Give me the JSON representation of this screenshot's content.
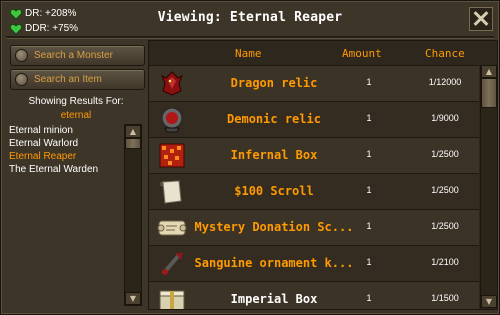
{
  "header": {
    "dr": "DR: +208%",
    "ddr": "DDR: +75%",
    "title": "Viewing: Eternal Reaper",
    "close_icon": "close-x-icon"
  },
  "left": {
    "search_monster": "Search a Monster",
    "search_item": "Search an Item",
    "results_label": "Showing Results For:",
    "query": "eternal",
    "results": [
      "Eternal minion",
      "Eternal Warlord",
      "Eternal Reaper",
      "The Eternal Warden"
    ],
    "selected_index": 2
  },
  "table": {
    "headers": {
      "name": "Name",
      "amount": "Amount",
      "chance": "Chance"
    },
    "rows": [
      {
        "icon": "dragon-relic-icon",
        "name": "Dragon relic",
        "amount": "1",
        "chance": "1/12000",
        "name_color": "orange"
      },
      {
        "icon": "demonic-relic-icon",
        "name": "Demonic relic",
        "amount": "1",
        "chance": "1/9000",
        "name_color": "orange"
      },
      {
        "icon": "infernal-box-icon",
        "name": "Infernal Box",
        "amount": "1",
        "chance": "1/2500",
        "name_color": "orange"
      },
      {
        "icon": "scroll-icon",
        "name": "$100 Scroll",
        "amount": "1",
        "chance": "1/2500",
        "name_color": "orange"
      },
      {
        "icon": "donation-scroll-icon",
        "name": "Mystery Donation Sc...",
        "amount": "1",
        "chance": "1/2500",
        "name_color": "orange"
      },
      {
        "icon": "ornament-kit-icon",
        "name": "Sanguine ornament k...",
        "amount": "1",
        "chance": "1/2100",
        "name_color": "orange"
      },
      {
        "icon": "imperial-box-icon",
        "name": "Imperial Box",
        "amount": "1",
        "chance": "1/1500",
        "name_color": "white"
      }
    ]
  },
  "colors": {
    "accent": "#ff9a00",
    "background": "#3e3529",
    "text": "#ffffff"
  }
}
